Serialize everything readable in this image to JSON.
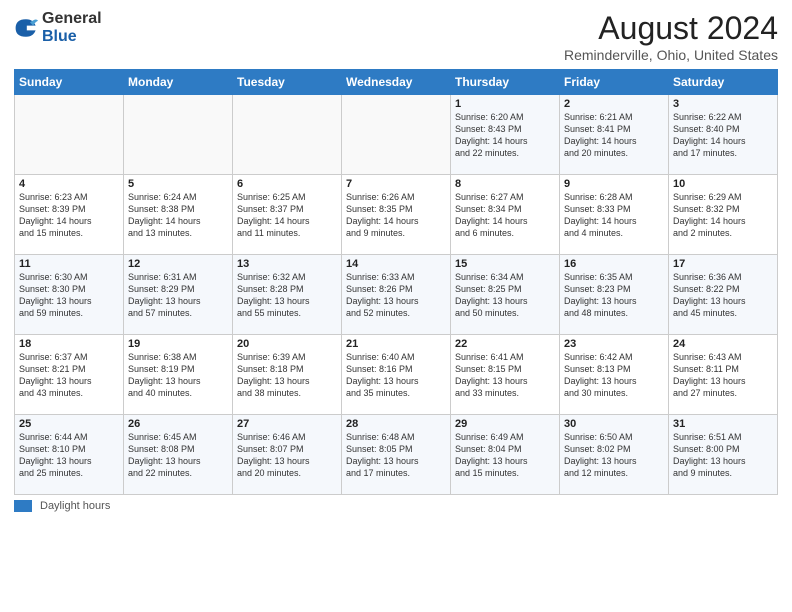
{
  "header": {
    "logo_general": "General",
    "logo_blue": "Blue",
    "month_year": "August 2024",
    "location": "Reminderville, Ohio, United States"
  },
  "days_of_week": [
    "Sunday",
    "Monday",
    "Tuesday",
    "Wednesday",
    "Thursday",
    "Friday",
    "Saturday"
  ],
  "weeks": [
    [
      {
        "day": "",
        "info": ""
      },
      {
        "day": "",
        "info": ""
      },
      {
        "day": "",
        "info": ""
      },
      {
        "day": "",
        "info": ""
      },
      {
        "day": "1",
        "info": "Sunrise: 6:20 AM\nSunset: 8:43 PM\nDaylight: 14 hours\nand 22 minutes."
      },
      {
        "day": "2",
        "info": "Sunrise: 6:21 AM\nSunset: 8:41 PM\nDaylight: 14 hours\nand 20 minutes."
      },
      {
        "day": "3",
        "info": "Sunrise: 6:22 AM\nSunset: 8:40 PM\nDaylight: 14 hours\nand 17 minutes."
      }
    ],
    [
      {
        "day": "4",
        "info": "Sunrise: 6:23 AM\nSunset: 8:39 PM\nDaylight: 14 hours\nand 15 minutes."
      },
      {
        "day": "5",
        "info": "Sunrise: 6:24 AM\nSunset: 8:38 PM\nDaylight: 14 hours\nand 13 minutes."
      },
      {
        "day": "6",
        "info": "Sunrise: 6:25 AM\nSunset: 8:37 PM\nDaylight: 14 hours\nand 11 minutes."
      },
      {
        "day": "7",
        "info": "Sunrise: 6:26 AM\nSunset: 8:35 PM\nDaylight: 14 hours\nand 9 minutes."
      },
      {
        "day": "8",
        "info": "Sunrise: 6:27 AM\nSunset: 8:34 PM\nDaylight: 14 hours\nand 6 minutes."
      },
      {
        "day": "9",
        "info": "Sunrise: 6:28 AM\nSunset: 8:33 PM\nDaylight: 14 hours\nand 4 minutes."
      },
      {
        "day": "10",
        "info": "Sunrise: 6:29 AM\nSunset: 8:32 PM\nDaylight: 14 hours\nand 2 minutes."
      }
    ],
    [
      {
        "day": "11",
        "info": "Sunrise: 6:30 AM\nSunset: 8:30 PM\nDaylight: 13 hours\nand 59 minutes."
      },
      {
        "day": "12",
        "info": "Sunrise: 6:31 AM\nSunset: 8:29 PM\nDaylight: 13 hours\nand 57 minutes."
      },
      {
        "day": "13",
        "info": "Sunrise: 6:32 AM\nSunset: 8:28 PM\nDaylight: 13 hours\nand 55 minutes."
      },
      {
        "day": "14",
        "info": "Sunrise: 6:33 AM\nSunset: 8:26 PM\nDaylight: 13 hours\nand 52 minutes."
      },
      {
        "day": "15",
        "info": "Sunrise: 6:34 AM\nSunset: 8:25 PM\nDaylight: 13 hours\nand 50 minutes."
      },
      {
        "day": "16",
        "info": "Sunrise: 6:35 AM\nSunset: 8:23 PM\nDaylight: 13 hours\nand 48 minutes."
      },
      {
        "day": "17",
        "info": "Sunrise: 6:36 AM\nSunset: 8:22 PM\nDaylight: 13 hours\nand 45 minutes."
      }
    ],
    [
      {
        "day": "18",
        "info": "Sunrise: 6:37 AM\nSunset: 8:21 PM\nDaylight: 13 hours\nand 43 minutes."
      },
      {
        "day": "19",
        "info": "Sunrise: 6:38 AM\nSunset: 8:19 PM\nDaylight: 13 hours\nand 40 minutes."
      },
      {
        "day": "20",
        "info": "Sunrise: 6:39 AM\nSunset: 8:18 PM\nDaylight: 13 hours\nand 38 minutes."
      },
      {
        "day": "21",
        "info": "Sunrise: 6:40 AM\nSunset: 8:16 PM\nDaylight: 13 hours\nand 35 minutes."
      },
      {
        "day": "22",
        "info": "Sunrise: 6:41 AM\nSunset: 8:15 PM\nDaylight: 13 hours\nand 33 minutes."
      },
      {
        "day": "23",
        "info": "Sunrise: 6:42 AM\nSunset: 8:13 PM\nDaylight: 13 hours\nand 30 minutes."
      },
      {
        "day": "24",
        "info": "Sunrise: 6:43 AM\nSunset: 8:11 PM\nDaylight: 13 hours\nand 27 minutes."
      }
    ],
    [
      {
        "day": "25",
        "info": "Sunrise: 6:44 AM\nSunset: 8:10 PM\nDaylight: 13 hours\nand 25 minutes."
      },
      {
        "day": "26",
        "info": "Sunrise: 6:45 AM\nSunset: 8:08 PM\nDaylight: 13 hours\nand 22 minutes."
      },
      {
        "day": "27",
        "info": "Sunrise: 6:46 AM\nSunset: 8:07 PM\nDaylight: 13 hours\nand 20 minutes."
      },
      {
        "day": "28",
        "info": "Sunrise: 6:48 AM\nSunset: 8:05 PM\nDaylight: 13 hours\nand 17 minutes."
      },
      {
        "day": "29",
        "info": "Sunrise: 6:49 AM\nSunset: 8:04 PM\nDaylight: 13 hours\nand 15 minutes."
      },
      {
        "day": "30",
        "info": "Sunrise: 6:50 AM\nSunset: 8:02 PM\nDaylight: 13 hours\nand 12 minutes."
      },
      {
        "day": "31",
        "info": "Sunrise: 6:51 AM\nSunset: 8:00 PM\nDaylight: 13 hours\nand 9 minutes."
      }
    ]
  ],
  "footer": {
    "legend_label": "Daylight hours"
  }
}
